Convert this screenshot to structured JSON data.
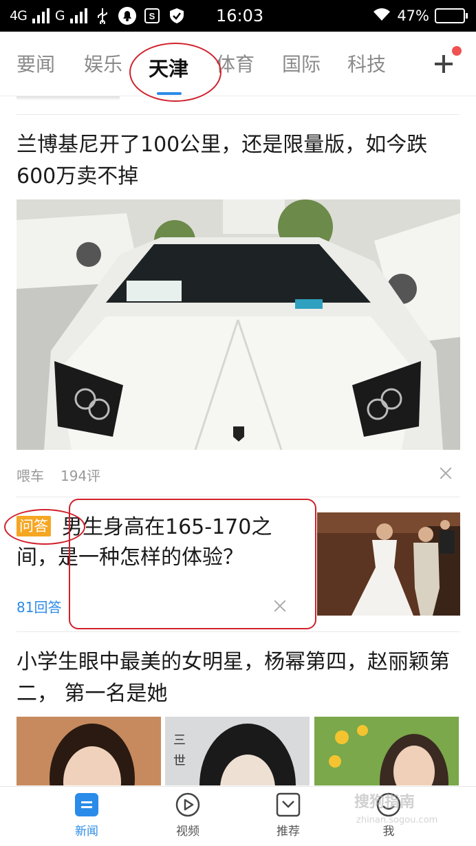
{
  "status_bar": {
    "network_1": "4G",
    "network_2": "G",
    "time": "16:03",
    "battery": "47%"
  },
  "tabs": [
    {
      "label": "要闻"
    },
    {
      "label": "娱乐"
    },
    {
      "label": "天津"
    },
    {
      "label": "体育"
    },
    {
      "label": "国际"
    },
    {
      "label": "科技"
    }
  ],
  "active_tab": "天津",
  "colors": {
    "accent": "#2a8be8",
    "badge": "#f5a623",
    "annotation": "#d0202a"
  },
  "feed": {
    "article1": {
      "title": "兰博基尼开了100公里，还是限量版，如今跌600万卖不掉",
      "source": "喂车",
      "comments": "194评"
    },
    "qa": {
      "badge": "问答",
      "title": "男生身高在165-170之间，是一种怎样的体验？",
      "answers": "81回答"
    },
    "article3": {
      "title": "小学生眼中最美的女明星，杨幂第四，赵丽颖第二， 第一名是她"
    }
  },
  "bottom_nav": [
    {
      "label": "新闻",
      "icon": "news-icon",
      "active": true
    },
    {
      "label": "视频",
      "icon": "video-play-icon",
      "active": false
    },
    {
      "label": "推荐",
      "icon": "recommend-icon",
      "active": false
    },
    {
      "label": "我",
      "icon": "profile-smile-icon",
      "active": false
    }
  ],
  "watermark": {
    "text": "搜狗指南",
    "sub": "zhinan.sogou.com"
  }
}
